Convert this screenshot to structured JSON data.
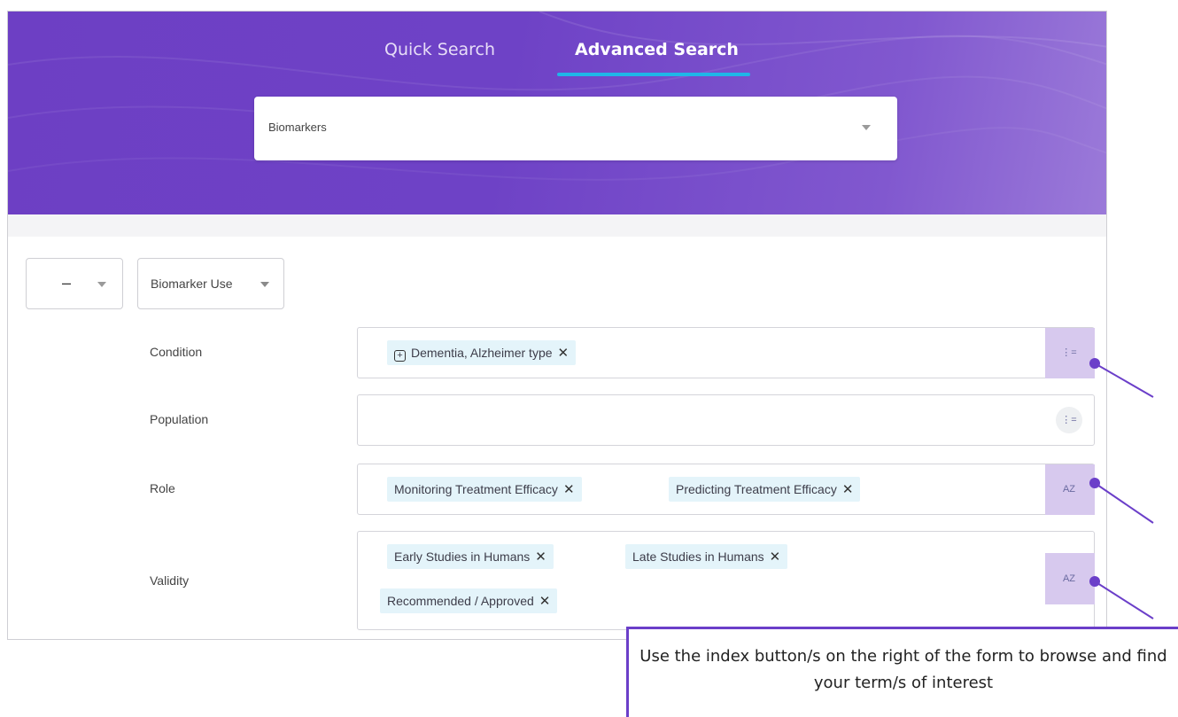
{
  "tabs": [
    {
      "label": "Quick Search",
      "active": false
    },
    {
      "label": "Advanced Search",
      "active": true
    }
  ],
  "search_category": {
    "value": "Biomarkers"
  },
  "query_row": {
    "operator": "–",
    "field": "Biomarker Use"
  },
  "rows": [
    {
      "label": "Condition",
      "chips": [
        "Dementia, Alzheimer type"
      ],
      "index_icon": "hierarchy-list-icon",
      "highlighted": true
    },
    {
      "label": "Population",
      "chips": [],
      "index_icon": "hierarchy-list-icon",
      "highlighted": false
    },
    {
      "label": "Role",
      "chips": [
        "Monitoring Treatment Efficacy",
        "Predicting Treatment Efficacy"
      ],
      "index_icon": "a-z-index-icon",
      "highlighted": true
    },
    {
      "label": "Validity",
      "chips": [
        "Early Studies in Humans",
        "Late Studies in Humans",
        "Recommended / Approved"
      ],
      "index_icon": "a-z-index-icon",
      "highlighted": true
    }
  ],
  "icons": {
    "hierarchy": "⋮=",
    "az": "AZ",
    "remove": "✕",
    "expand": "+"
  },
  "callout": {
    "text": "Use the index button/s on the right of the form to browse and find your term/s of interest"
  },
  "colors": {
    "brand_purple": "#6d3fc4",
    "tab_underline": "#1fb6e8",
    "chip_bg": "#e4f4fa",
    "highlight": "#d7c9ee",
    "annotation": "#6b3fc9"
  }
}
